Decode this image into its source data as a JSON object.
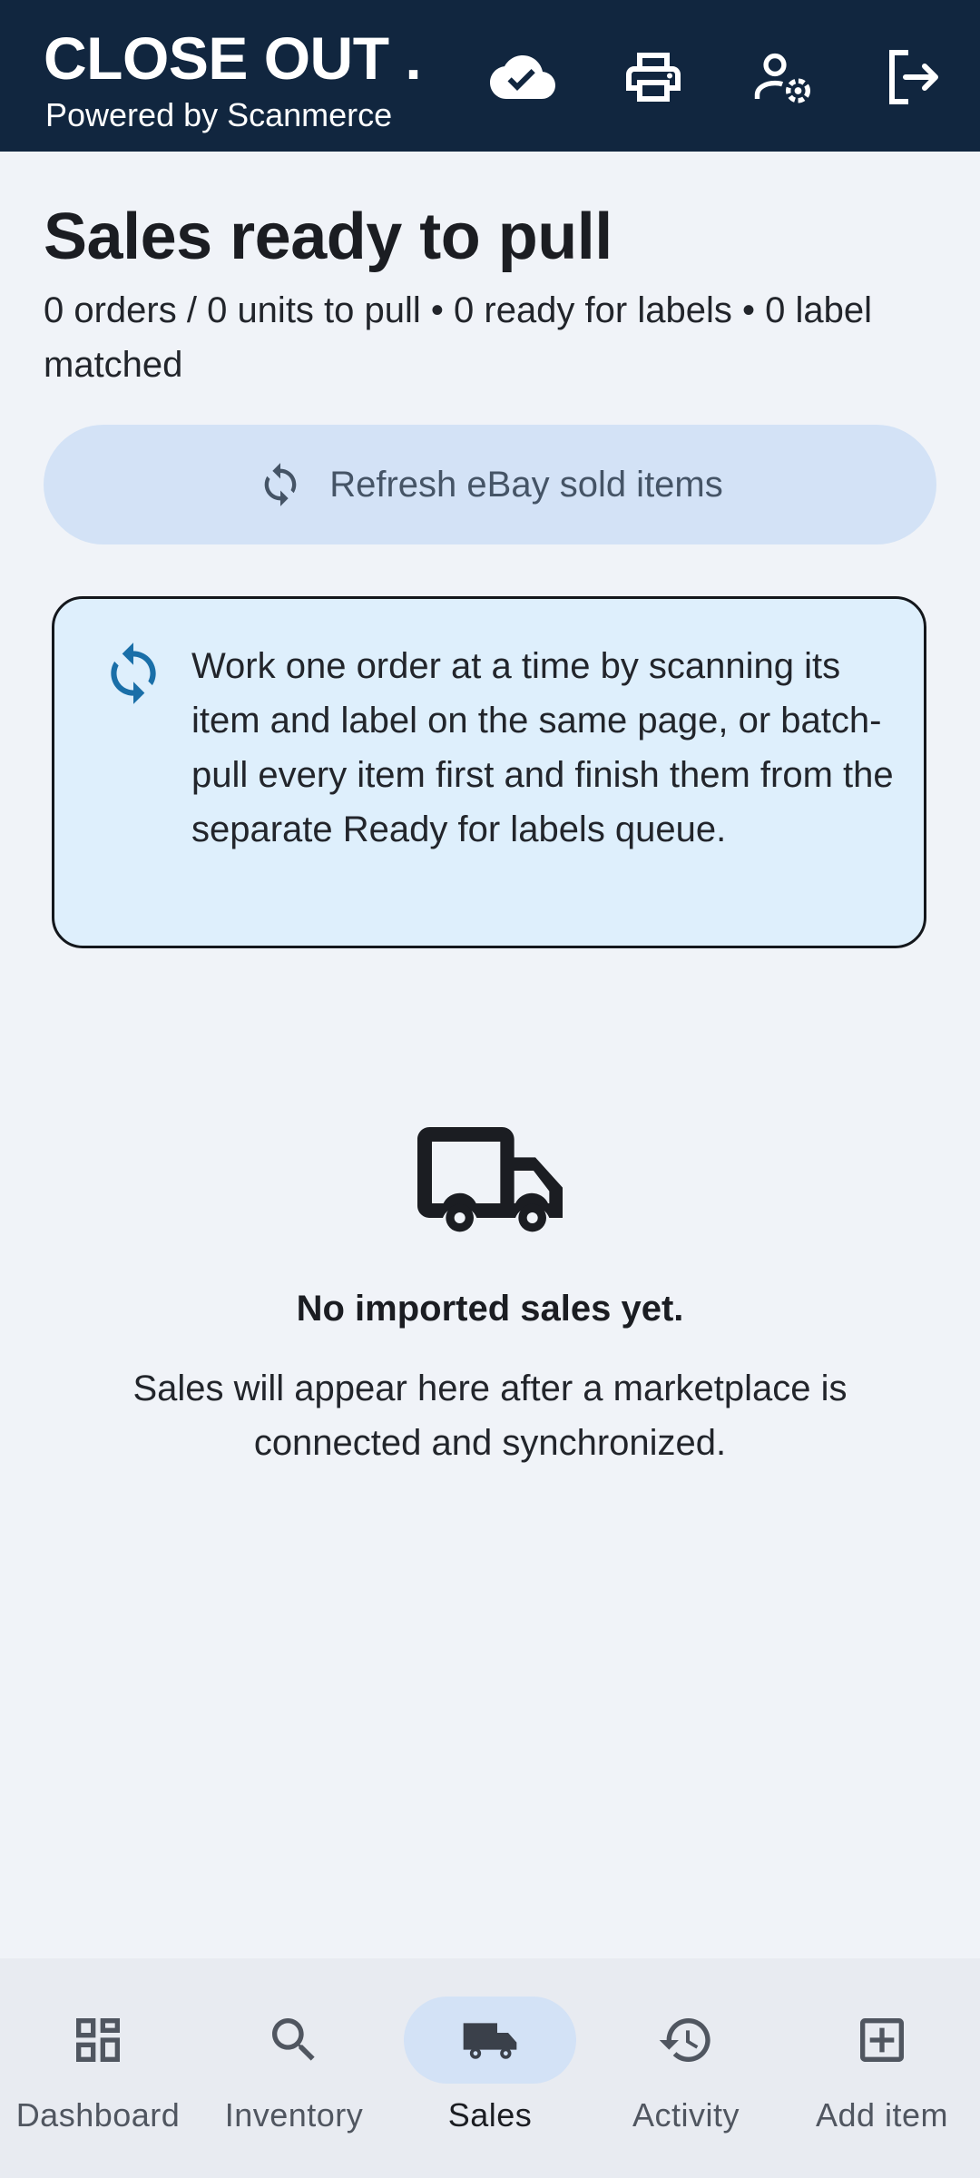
{
  "appbar": {
    "title": "CLOSE OUT ...",
    "subtitle": "Powered by Scanmerce",
    "icons": [
      "cloud-done-icon",
      "printer-icon",
      "account-settings-icon",
      "logout-icon"
    ]
  },
  "page": {
    "title": "Sales ready to pull",
    "summary": "0 orders / 0 units to pull • 0 ready for labels • 0 label matched"
  },
  "refresh_button": {
    "label": "Refresh eBay sold items",
    "icon": "sync-icon"
  },
  "info_card": {
    "icon": "sync-icon",
    "text": "Work one order at a time by scanning its item and label on the same page, or batch-pull every item first and finish them from the separate Ready for labels queue."
  },
  "empty_state": {
    "icon": "truck-icon",
    "title": "No imported sales yet.",
    "text": "Sales will appear here after a marketplace is connected and synchronized."
  },
  "bottom_nav": {
    "items": [
      {
        "label": "Dashboard",
        "icon": "dashboard-icon"
      },
      {
        "label": "Inventory",
        "icon": "search-icon"
      },
      {
        "label": "Sales",
        "icon": "truck-icon",
        "active": true
      },
      {
        "label": "Activity",
        "icon": "history-icon"
      },
      {
        "label": "Add item",
        "icon": "add-box-icon"
      }
    ]
  },
  "colors": {
    "appbar": "#11263f",
    "background": "#f0f3f8",
    "accent_pill": "#d3e2f6",
    "info_card": "#deeffc",
    "info_icon": "#1a6fa8"
  }
}
